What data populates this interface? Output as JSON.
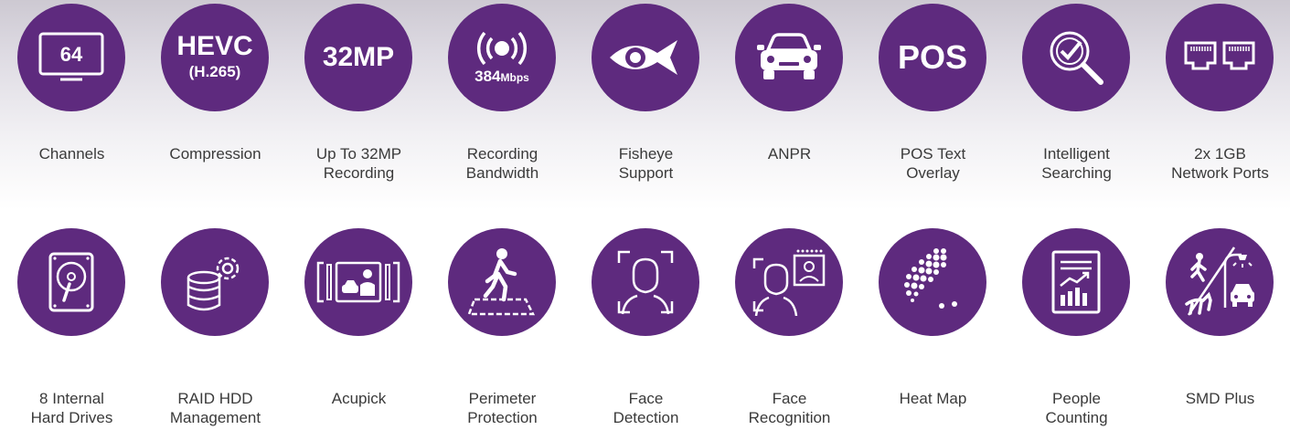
{
  "features_row1": [
    {
      "icon": "monitor-icon",
      "icon_text": "64",
      "label": [
        "Channels"
      ]
    },
    {
      "icon": "compression-badge-icon",
      "icon_text": [
        "HEVC",
        "(H.265)"
      ],
      "label": [
        "Compression"
      ]
    },
    {
      "icon": "resolution-badge-icon",
      "icon_text": "32MP",
      "label": [
        "Up To 32MP",
        "Recording"
      ]
    },
    {
      "icon": "broadcast-icon",
      "icon_text": [
        "384",
        "Mbps"
      ],
      "label": [
        "Recording",
        "Bandwidth"
      ]
    },
    {
      "icon": "fisheye-icon",
      "label": [
        "Fisheye",
        "Support"
      ]
    },
    {
      "icon": "car-icon",
      "label": [
        "ANPR"
      ]
    },
    {
      "icon": "pos-badge-icon",
      "icon_text": "POS",
      "label": [
        "POS Text",
        "Overlay"
      ]
    },
    {
      "icon": "magnifier-check-icon",
      "label": [
        "Intelligent",
        "Searching"
      ]
    },
    {
      "icon": "network-ports-icon",
      "label": [
        "2x 1GB",
        "Network Ports"
      ]
    }
  ],
  "features_row2": [
    {
      "icon": "hard-drive-icon",
      "label": [
        "8 Internal",
        "Hard Drives"
      ]
    },
    {
      "icon": "database-gear-icon",
      "label": [
        "RAID HDD",
        "Management"
      ]
    },
    {
      "icon": "acupick-icon",
      "label": [
        "Acupick"
      ]
    },
    {
      "icon": "walking-person-icon",
      "label": [
        "Perimeter",
        "Protection"
      ]
    },
    {
      "icon": "face-detection-icon",
      "label": [
        "Face",
        "Detection"
      ]
    },
    {
      "icon": "face-recognition-icon",
      "label": [
        "Face",
        "Recognition"
      ]
    },
    {
      "icon": "heat-map-icon",
      "label": [
        "Heat Map"
      ]
    },
    {
      "icon": "people-counting-report-icon",
      "label": [
        "People",
        "Counting"
      ]
    },
    {
      "icon": "smd-plus-icon",
      "label": [
        "SMD Plus"
      ]
    }
  ],
  "colors": {
    "circle": "#5e2a7e",
    "label_text": "#3a3a3a",
    "icon": "#ffffff"
  }
}
